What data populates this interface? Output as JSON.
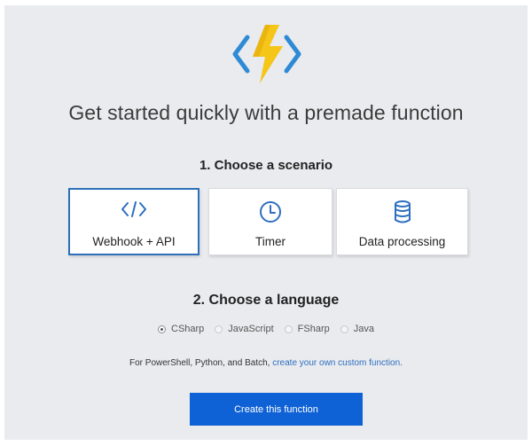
{
  "header": {
    "logo_icon": "azure-functions-bolt-icon",
    "headline": "Get started quickly with a premade function"
  },
  "scenario": {
    "heading": "1. Choose a scenario",
    "cards": [
      {
        "label": "Webhook + API",
        "icon": "code-brackets-icon",
        "selected": true
      },
      {
        "label": "Timer",
        "icon": "clock-icon",
        "selected": false
      },
      {
        "label": "Data processing",
        "icon": "database-icon",
        "selected": false
      }
    ]
  },
  "language": {
    "heading": "2. Choose a language",
    "options": [
      {
        "label": "CSharp",
        "checked": true
      },
      {
        "label": "JavaScript",
        "checked": false
      },
      {
        "label": "FSharp",
        "checked": false
      },
      {
        "label": "Java",
        "checked": false
      }
    ]
  },
  "footnote": {
    "prefix": "For PowerShell, Python, and Batch,",
    "link": "create your own custom function."
  },
  "actions": {
    "create_label": "Create this function"
  },
  "colors": {
    "accent": "#0f62d6",
    "selected_border": "#2d6fb8",
    "bolt_yellow": "#f5c518",
    "bracket_blue": "#2f8ad6"
  }
}
